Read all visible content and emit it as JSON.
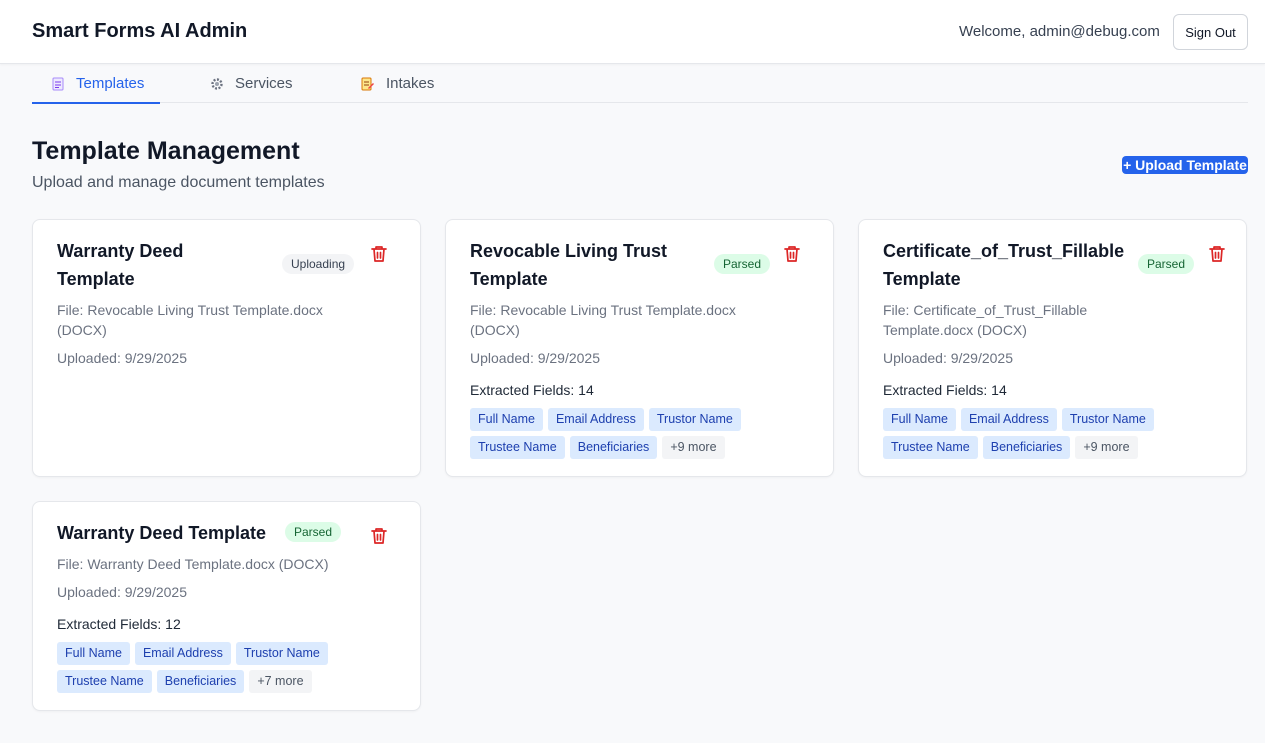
{
  "header": {
    "app_title": "Smart Forms AI Admin",
    "welcome": "Welcome, admin@debug.com",
    "sign_out": "Sign Out"
  },
  "tabs": [
    {
      "label": "Templates",
      "icon": "document-icon",
      "active": true
    },
    {
      "label": "Services",
      "icon": "gear-icon",
      "active": false
    },
    {
      "label": "Intakes",
      "icon": "edit-document-icon",
      "active": false
    }
  ],
  "page": {
    "title": "Template Management",
    "subtitle": "Upload and manage document templates",
    "upload_button": "+ Upload Template"
  },
  "colors": {
    "accent": "#2563eb",
    "delete": "#dc2626",
    "parsed_badge_bg": "#dcfce7",
    "chip_bg": "#dbeafe"
  },
  "templates": [
    {
      "title_line1": "Warranty Deed",
      "title_line2": "Template",
      "status": "Uploading",
      "file_line1": "File: Revocable Living Trust Template.docx",
      "file_line2": "(DOCX)",
      "uploaded": "Uploaded: 9/29/2025"
    },
    {
      "title_line1": "Revocable Living Trust",
      "title_line2": "Template",
      "status": "Parsed",
      "file_line1": "File: Revocable Living Trust Template.docx",
      "file_line2": "(DOCX)",
      "uploaded": "Uploaded: 9/29/2025",
      "extracted": "Extracted Fields: 14",
      "fields": [
        "Full Name",
        "Email Address",
        "Trustor Name",
        "Trustee Name",
        "Beneficiaries"
      ],
      "more": "+9 more"
    },
    {
      "title_line1": "Certificate_of_Trust_Fillable",
      "title_line2": "Template",
      "status": "Parsed",
      "file_line1": "File: Certificate_of_Trust_Fillable",
      "file_line2": "Template.docx (DOCX)",
      "uploaded": "Uploaded: 9/29/2025",
      "extracted": "Extracted Fields: 14",
      "fields": [
        "Full Name",
        "Email Address",
        "Trustor Name",
        "Trustee Name",
        "Beneficiaries"
      ],
      "more": "+9 more"
    },
    {
      "title_line1": "Warranty Deed Template",
      "status": "Parsed",
      "file_line1": "File: Warranty Deed Template.docx (DOCX)",
      "uploaded": "Uploaded: 9/29/2025",
      "extracted": "Extracted Fields: 12",
      "fields": [
        "Full Name",
        "Email Address",
        "Trustor Name",
        "Trustee Name",
        "Beneficiaries"
      ],
      "more": "+7 more"
    }
  ]
}
